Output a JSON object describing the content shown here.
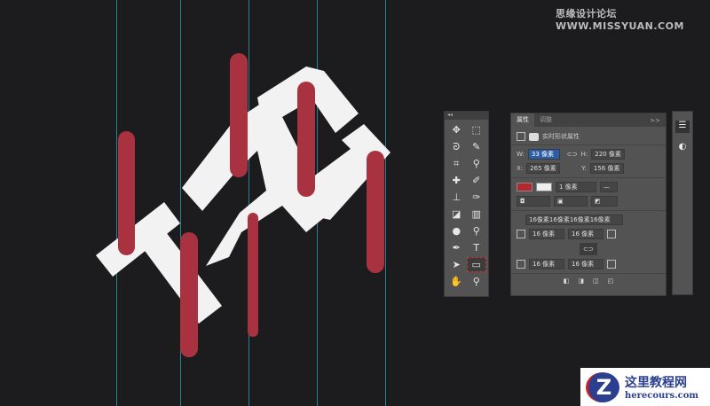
{
  "watermark_top": "思缘设计论坛 WWW.MISSYUAN.COM",
  "colors": {
    "bar": "#a8323f",
    "guide": "#2aa6b8",
    "fill": "#b5262f"
  },
  "toolbar": {
    "header": "◂◂",
    "tools": [
      {
        "icon": "move-icon",
        "g": "✥"
      },
      {
        "icon": "marquee-icon",
        "g": "⬚"
      },
      {
        "icon": "lasso-icon",
        "g": "ᘐ"
      },
      {
        "icon": "quick-select-icon",
        "g": "✎"
      },
      {
        "icon": "crop-icon",
        "g": "⌗"
      },
      {
        "icon": "eyedropper-icon",
        "g": "⚲"
      },
      {
        "icon": "healing-icon",
        "g": "✚"
      },
      {
        "icon": "brush-icon",
        "g": "✐"
      },
      {
        "icon": "stamp-icon",
        "g": "⊥"
      },
      {
        "icon": "history-brush-icon",
        "g": "✑"
      },
      {
        "icon": "eraser-icon",
        "g": "◪"
      },
      {
        "icon": "gradient-icon",
        "g": "▥"
      },
      {
        "icon": "blur-icon",
        "g": "●"
      },
      {
        "icon": "dodge-icon",
        "g": "⚲"
      },
      {
        "icon": "pen-icon",
        "g": "✒"
      },
      {
        "icon": "type-icon",
        "g": "T"
      },
      {
        "icon": "path-select-icon",
        "g": "➤"
      },
      {
        "icon": "rectangle-icon",
        "g": "▭"
      },
      {
        "icon": "hand-icon",
        "g": "✋"
      },
      {
        "icon": "zoom-icon",
        "g": "⚲"
      }
    ]
  },
  "properties": {
    "tab1": "属性",
    "tab2": "调整",
    "more": ">>",
    "title": "实时形状属性",
    "w_label": "W:",
    "w": "33 像素",
    "h_label": "H:",
    "h": "220 像素",
    "x_label": "X:",
    "x": "265 像素",
    "y_label": "Y:",
    "y": "156 像素",
    "stroke_width": "1 像素",
    "corners_all": "16像素16像素16像素16像素",
    "c_tl": "16 像素",
    "c_tr": "16 像素",
    "c_bl": "16 像素",
    "c_br": "16 像素"
  },
  "logo": {
    "title": "这里教程网",
    "url": "herecours.com",
    "mark": "Z"
  }
}
